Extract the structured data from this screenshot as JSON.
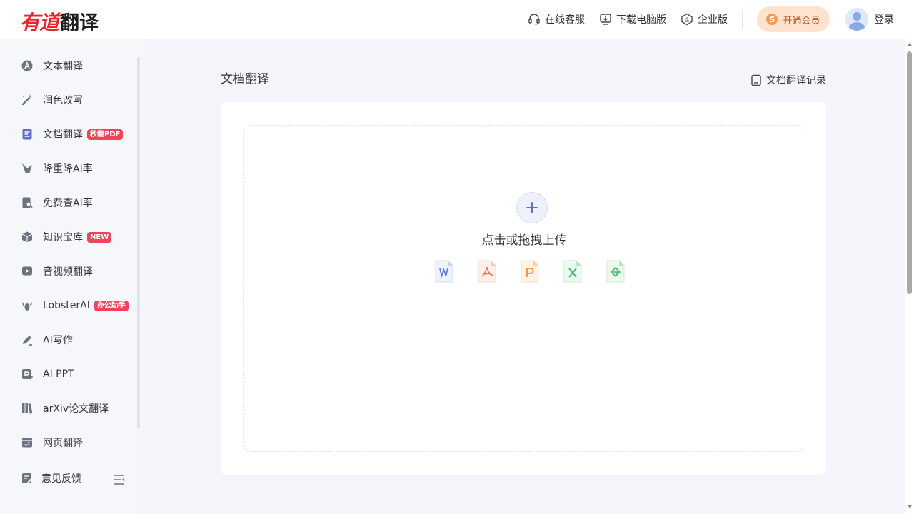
{
  "header": {
    "logo_brand": "有道",
    "logo_product": "翻译",
    "nav": [
      {
        "label": "在线客服",
        "icon": "headset-icon"
      },
      {
        "label": "下载电脑版",
        "icon": "download-icon"
      },
      {
        "label": "企业版",
        "icon": "enterprise-icon"
      }
    ],
    "vip_label": "开通会员",
    "login_label": "登录"
  },
  "sidebar": {
    "items": [
      {
        "label": "文本翻译",
        "icon": "text-translate-icon"
      },
      {
        "label": "润色改写",
        "icon": "magic-wand-icon"
      },
      {
        "label": "文档翻译",
        "icon": "document-icon",
        "badge": "秒翻PDF",
        "active": true
      },
      {
        "label": "降重降AI率",
        "icon": "reduce-icon"
      },
      {
        "label": "免费查AI率",
        "icon": "search-doc-icon"
      },
      {
        "label": "知识宝库",
        "icon": "cube-icon",
        "badge": "NEW"
      },
      {
        "label": "音视频翻译",
        "icon": "video-icon"
      },
      {
        "label": "LobsterAI",
        "icon": "lobster-icon",
        "badge": "办公助手"
      },
      {
        "label": "AI写作",
        "icon": "pen-icon"
      },
      {
        "label": "AI PPT",
        "icon": "ppt-icon"
      },
      {
        "label": "arXiv论文翻译",
        "icon": "books-icon"
      },
      {
        "label": "网页翻译",
        "icon": "webpage-icon"
      }
    ],
    "feedback_label": "意见反馈"
  },
  "main": {
    "title": "文档翻译",
    "history_label": "文档翻译记录",
    "drop_text": "点击或拖拽上传",
    "file_types": [
      "word",
      "pdf",
      "ppt",
      "excel",
      "epub"
    ]
  },
  "colors": {
    "brand_red": "#e5262a",
    "accent_blue": "#5b6fd6",
    "badge_red": "#f0445a",
    "vip_bg": "#ffe3cf"
  }
}
